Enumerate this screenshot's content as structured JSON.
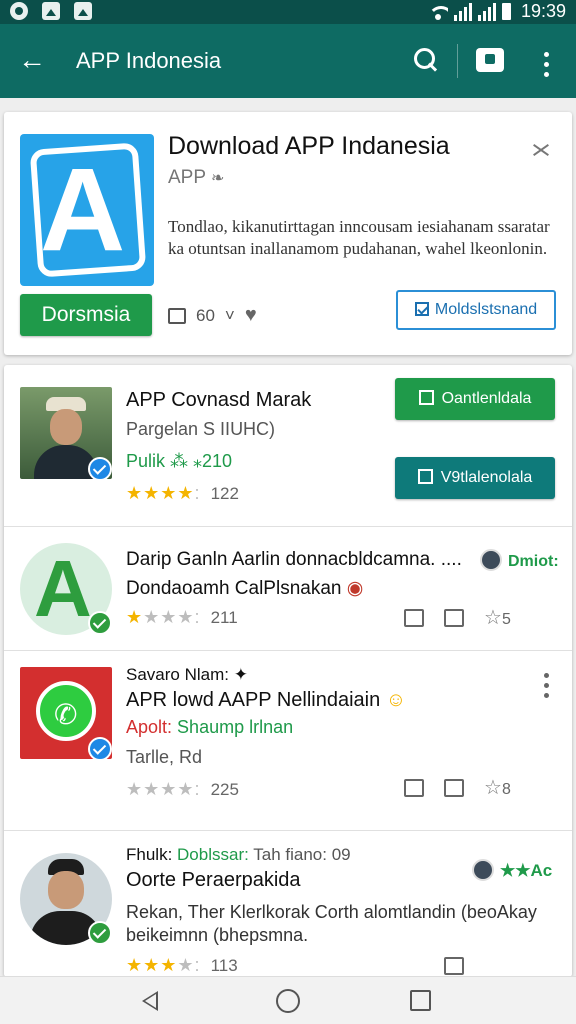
{
  "status_bar": {
    "time": "19:39",
    "icons": [
      "notification-icon",
      "image-icon",
      "app-icon",
      "wifi-icon",
      "signal-icon",
      "battery-icon"
    ]
  },
  "app_bar": {
    "title": "APP Indonesia",
    "icons": [
      "back-arrow-icon",
      "search-icon",
      "store-icon",
      "more-vert-icon"
    ]
  },
  "featured": {
    "title": "Download APP Indanesia",
    "subtitle": "APP",
    "description": "Tondlao, kikanutirttagan inncousam iesiahanam ssaratar ka otuntsan inallanamom pudahanan, wahel lkeonlonin.",
    "install_label": "Dorsmsia",
    "stat_count": "60",
    "secondary_label": "Moldslstsnand",
    "icon_letter": "A",
    "icon_color": "#27a3e8"
  },
  "list": [
    {
      "title": "APP Covnasd Marak",
      "line2": "Pargelan S IIUHC)",
      "line3": "Pulik ⁂ ⁎210",
      "rating_count": "122",
      "stars": 4,
      "button1": "Oantlenldala",
      "button2": "V9tlalenolala",
      "button1_color": "#1f9a4a",
      "button2_color": "#0e7a7a"
    },
    {
      "title": "Darip Ganln Aarlin donnacbldcamna. ....",
      "title_badge": "Dmiot:",
      "line2": "Dondaoamh CalPlsnakan",
      "rating_count": "211",
      "stars": 1,
      "action_count": "5"
    },
    {
      "header": "Savaro Nlam:",
      "title": "APR lowd AAPP Nellindaiain",
      "line2_a": "Apolt:",
      "line2_b": "Shaump lrlnan",
      "line3": "Tarlle, Rd",
      "rating_count": "225",
      "stars": 0,
      "action_count": "8"
    },
    {
      "header_a": "Fhulk:",
      "header_b": "Doblssar:",
      "header_c": "Tah fiano: 09",
      "title": "Oorte Peraerpakida",
      "title_badge": "★★Ac",
      "desc": "Rekan, Ther Klerlkorak Corth alomtlandin (beoAkay beikeimnn (bhepsmna.",
      "rating_count": "113",
      "stars": 3
    }
  ]
}
